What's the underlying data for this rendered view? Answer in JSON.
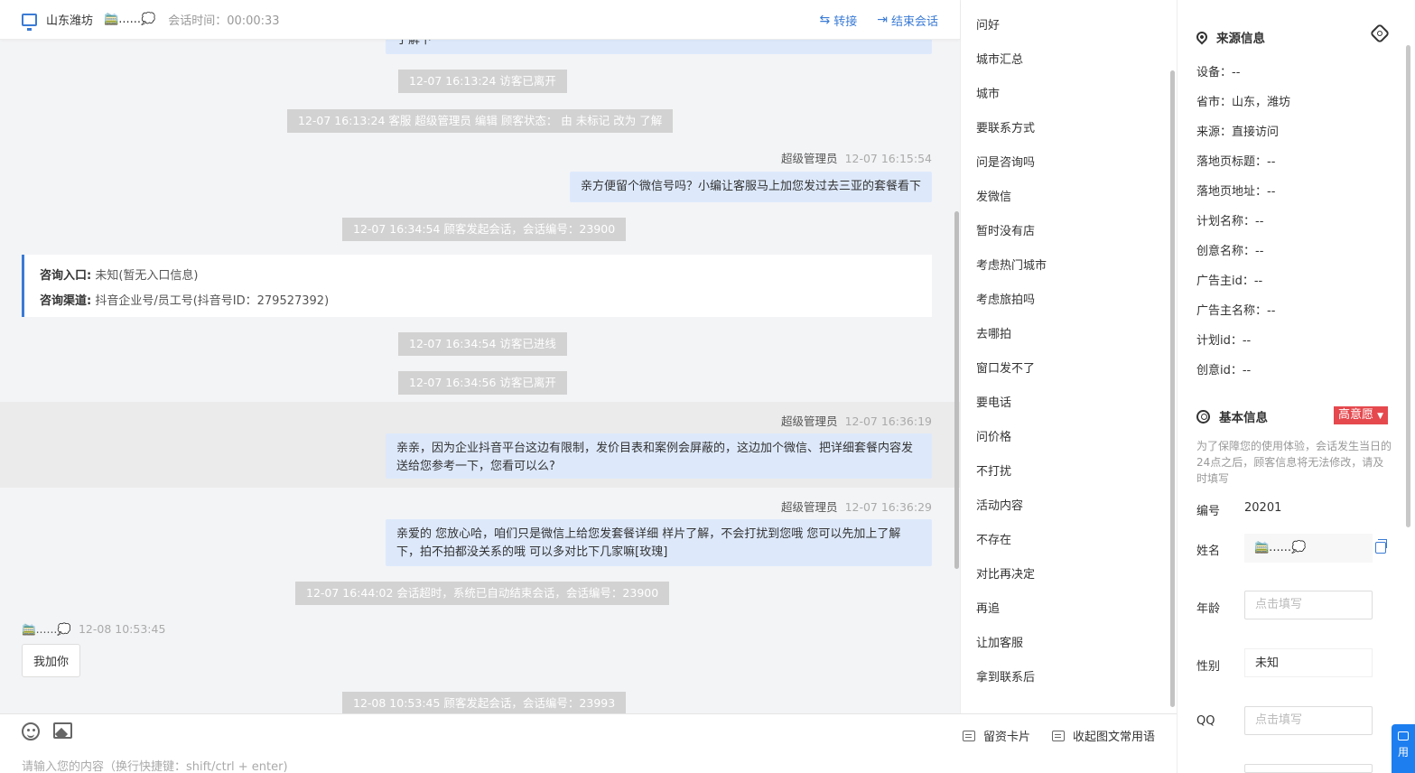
{
  "header": {
    "location": "山东潍坊",
    "visitor_name": "🚞......💭",
    "session_time": "会话时间：00:00:33",
    "transfer_label": "转接",
    "end_label": "结束会话"
  },
  "chat": {
    "top_cut_text": "了解下",
    "sys1": "12-07 16:13:24 访客已离开",
    "sys2": "12-07 16:13:24 客服 超级管理员 编辑 顾客状态： 由 未标记 改为 了解",
    "msg1_sender": "超级管理员",
    "msg1_time": "12-07 16:15:54",
    "msg1_text": "亲方便留个微信号吗？小编让客服马上加您发过去三亚的套餐看下",
    "sys3": "12-07 16:34:54 顾客发起会话，会话编号：23900",
    "card_entry_label": "咨询入口:",
    "card_entry_value": "未知(暂无入口信息)",
    "card_channel_label": "咨询渠道:",
    "card_channel_value": "抖音企业号/员工号(抖音号ID：279527392)",
    "sys4": "12-07 16:34:54 访客已进线",
    "sys5": "12-07 16:34:56 访客已离开",
    "msg2_sender": "超级管理员",
    "msg2_time": "12-07 16:36:19",
    "msg2_text": "亲亲，因为企业抖音平台这边有限制，发价目表和案例会屏蔽的，这边加个微信、把详细套餐内容发送给您参考一下，您看可以么?",
    "msg3_sender": "超级管理员",
    "msg3_time": "12-07 16:36:29",
    "msg3_text": "亲爱的 您放心哈，咱们只是微信上给您发套餐详细 样片了解，不会打扰到您哦 您可以先加上了解下，拍不拍都没关系的哦 可以多对比下几家嘛[玫瑰]",
    "sys6": "12-07 16:44:02 会话超时，系统已自动结束会话，会话编号：23900",
    "visitor_sender": "🚞......💭",
    "visitor_time": "12-08 10:53:45",
    "visitor_text": "我加你",
    "sys7": "12-08 10:53:45 顾客发起会话，会话编号：23993"
  },
  "input": {
    "placeholder": "请输入您的内容（换行快捷键：shift/ctrl + enter)",
    "card_btn": "留资卡片",
    "collapse_btn": "收起图文常用语"
  },
  "phrases": [
    "问好",
    "城市汇总",
    "城市",
    "要联系方式",
    "问是咨询吗",
    "发微信",
    "暂时没有店",
    "考虑热门城市",
    "考虑旅拍吗",
    "去哪拍",
    "窗口发不了",
    "要电话",
    "问价格",
    "不打扰",
    "活动内容",
    "不存在",
    "对比再决定",
    "再追",
    "让加客服",
    "拿到联系后"
  ],
  "source": {
    "title": "来源信息",
    "rows": [
      "设备：--",
      "省市：山东，潍坊",
      "来源：直接访问",
      "落地页标题：--",
      "落地页地址：--",
      "计划名称：--",
      "创意名称：--",
      "广告主id：--",
      "广告主名称：--",
      "计划id：--",
      "创意id：--"
    ]
  },
  "basic": {
    "title": "基本信息",
    "intent": "高意愿",
    "notice": "为了保障您的使用体验，会话发生当日的24点之后，顾客信息将无法修改，请及时填写",
    "id_label": "编号",
    "id_value": "20201",
    "name_label": "姓名",
    "name_value": "🚞......💭",
    "age_label": "年龄",
    "age_placeholder": "点击填写",
    "gender_label": "性别",
    "gender_value": "未知",
    "qq_label": "QQ",
    "qq_placeholder": "点击填写"
  },
  "float_btn": "用"
}
